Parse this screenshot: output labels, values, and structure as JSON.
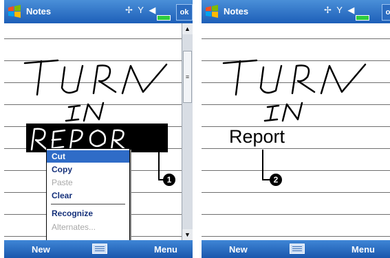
{
  "colors": {
    "titlebar": "#1d5fb8",
    "selection": "#2f6cc7",
    "ink": "#000000"
  },
  "screens": [
    {
      "title": "Notes",
      "status_icons": "✚ₕ Ÿₓ ◀€",
      "ok_label": "ok",
      "ink_words": [
        "TURN",
        "IN",
        "REPORT"
      ],
      "context_menu": {
        "items": [
          {
            "label": "Cut",
            "state": "highlighted"
          },
          {
            "label": "Copy",
            "state": "enabled"
          },
          {
            "label": "Paste",
            "state": "disabled"
          },
          {
            "label": "Clear",
            "state": "enabled"
          },
          {
            "label": "Recognize",
            "state": "enabled"
          },
          {
            "label": "Alternates...",
            "state": "disabled"
          }
        ]
      },
      "callout_number": "1",
      "bottom_bar": {
        "left": "New",
        "right": "Menu",
        "center_icon": "keyboard-icon"
      }
    },
    {
      "title": "Notes",
      "status_icons": "✚ₕ Ÿₓ ◀€",
      "ok_label": "ok",
      "ink_words": [
        "TURN",
        "IN"
      ],
      "recognized_text": "Report",
      "callout_number": "2",
      "bottom_bar": {
        "left": "New",
        "right": "Menu",
        "center_icon": "keyboard-icon"
      }
    }
  ]
}
